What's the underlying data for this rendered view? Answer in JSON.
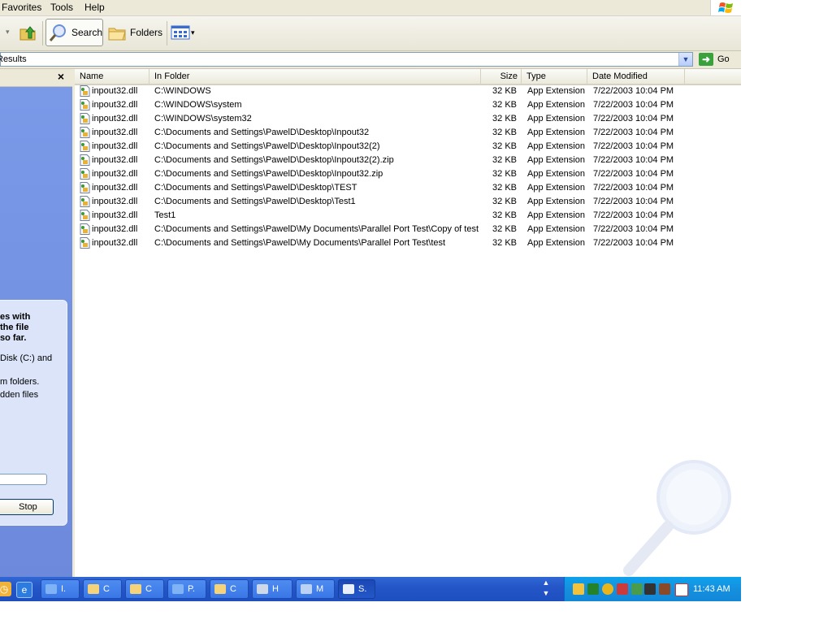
{
  "menu": {
    "items": [
      "Favorites",
      "Tools",
      "Help"
    ]
  },
  "toolbar": {
    "search_label": "Search",
    "folders_label": "Folders"
  },
  "address": {
    "value": "Results",
    "go_label": "Go"
  },
  "left_pane": {
    "close": "×",
    "text_lines": [
      "es with",
      "the file",
      "so far.",
      "Disk (C:) and",
      "m folders.",
      "dden files"
    ],
    "stop_label": "Stop"
  },
  "columns": [
    "Name",
    "In Folder",
    "Size",
    "Type",
    "Date Modified"
  ],
  "files": [
    {
      "name": "inpout32.dll",
      "folder": "C:\\WINDOWS",
      "size": "32 KB",
      "type": "App Extension",
      "date": "7/22/2003 10:04 PM"
    },
    {
      "name": "inpout32.dll",
      "folder": "C:\\WINDOWS\\system",
      "size": "32 KB",
      "type": "App Extension",
      "date": "7/22/2003 10:04 PM"
    },
    {
      "name": "inpout32.dll",
      "folder": "C:\\WINDOWS\\system32",
      "size": "32 KB",
      "type": "App Extension",
      "date": "7/22/2003 10:04 PM"
    },
    {
      "name": "inpout32.dll",
      "folder": "C:\\Documents and Settings\\PawelD\\Desktop\\Inpout32",
      "size": "32 KB",
      "type": "App Extension",
      "date": "7/22/2003 10:04 PM"
    },
    {
      "name": "inpout32.dll",
      "folder": "C:\\Documents and Settings\\PawelD\\Desktop\\Inpout32(2)",
      "size": "32 KB",
      "type": "App Extension",
      "date": "7/22/2003 10:04 PM"
    },
    {
      "name": "inpout32.dll",
      "folder": "C:\\Documents and Settings\\PawelD\\Desktop\\Inpout32(2).zip",
      "size": "32 KB",
      "type": "App Extension",
      "date": "7/22/2003 10:04 PM"
    },
    {
      "name": "inpout32.dll",
      "folder": "C:\\Documents and Settings\\PawelD\\Desktop\\Inpout32.zip",
      "size": "32 KB",
      "type": "App Extension",
      "date": "7/22/2003 10:04 PM"
    },
    {
      "name": "inpout32.dll",
      "folder": "C:\\Documents and Settings\\PawelD\\Desktop\\TEST",
      "size": "32 KB",
      "type": "App Extension",
      "date": "7/22/2003 10:04 PM"
    },
    {
      "name": "inpout32.dll",
      "folder": "C:\\Documents and Settings\\PawelD\\Desktop\\Test1",
      "size": "32 KB",
      "type": "App Extension",
      "date": "7/22/2003 10:04 PM"
    },
    {
      "name": "inpout32.dll",
      "folder": "Test1",
      "size": "32 KB",
      "type": "App Extension",
      "date": "7/22/2003 10:04 PM"
    },
    {
      "name": "inpout32.dll",
      "folder": "C:\\Documents and Settings\\PawelD\\My Documents\\Parallel Port Test\\Copy of test",
      "size": "32 KB",
      "type": "App Extension",
      "date": "7/22/2003 10:04 PM"
    },
    {
      "name": "inpout32.dll",
      "folder": "C:\\Documents and Settings\\PawelD\\My Documents\\Parallel Port Test\\test",
      "size": "32 KB",
      "type": "App Extension",
      "date": "7/22/2003 10:04 PM"
    }
  ],
  "taskbar": {
    "tasks": [
      {
        "label": "I.",
        "icon": "ie-icon"
      },
      {
        "label": "C",
        "icon": "folder-icon"
      },
      {
        "label": "C",
        "icon": "folder-icon"
      },
      {
        "label": "P.",
        "icon": "ie-icon"
      },
      {
        "label": "C",
        "icon": "folder-icon"
      },
      {
        "label": "H",
        "icon": "hyperterminal-icon"
      },
      {
        "label": "M",
        "icon": "media-icon"
      },
      {
        "label": "S.",
        "icon": "search-results-icon"
      }
    ],
    "clock": "11:43 AM"
  },
  "colors": {
    "taskbar": "#2456c8",
    "tray": "#1590de",
    "left_pane": "#6f8de1"
  }
}
